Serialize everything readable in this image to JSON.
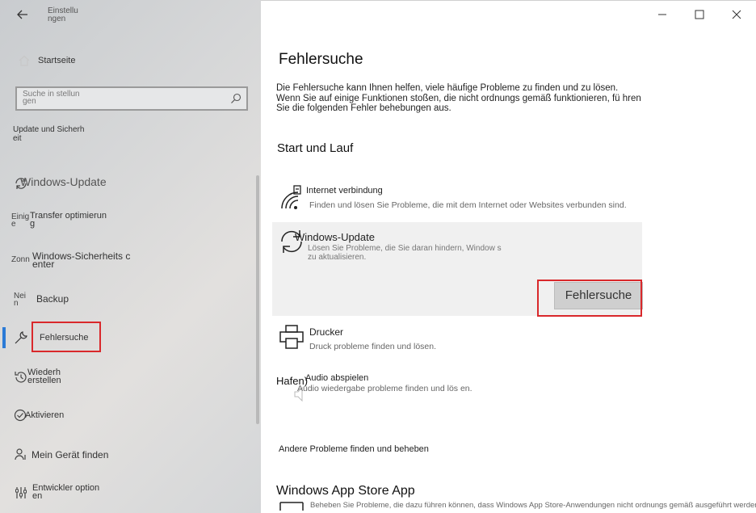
{
  "window": {
    "title": "Einstellu ngen"
  },
  "sidebar": {
    "home_label": "Startseite",
    "search_placeholder": "Suche in stellun gen",
    "section_label": "Update und Sicherh eit",
    "items": [
      {
        "label": "Windows-Update",
        "icon": "sync-icon"
      },
      {
        "prefix": "Einig e",
        "label": "Transfer optimierun g",
        "icon": "transfer-icon"
      },
      {
        "prefix": "Zonn",
        "label": "Windows-Sicherheits c enter",
        "icon": "shield-icon"
      },
      {
        "prefix": "Nei n",
        "label": "Backup",
        "icon": "backup-icon"
      },
      {
        "label": "Fehlersuche",
        "icon": "wrench-icon",
        "active": true
      },
      {
        "label": "Wiederh erstellen",
        "icon": "restore-icon"
      },
      {
        "label": "Aktivieren",
        "icon": "check-circle-icon"
      },
      {
        "label": "Mein Gerät finden",
        "icon": "person-pin-icon"
      },
      {
        "label": "Entwickler option en",
        "icon": "developer-icon"
      }
    ]
  },
  "main": {
    "title": "Fehlersuche",
    "intro": "Die Fehlersuche kann Ihnen helfen, viele häufige Probleme zu finden und zu lösen. Wenn Sie auf einige Funktionen stoßen, die nicht ordnungs gemäß funktionieren, fü hren Sie die folgenden Fehler behebungen aus.",
    "section_start": "Start und Lauf",
    "troubleshooters": [
      {
        "name": "Internet verbindung",
        "desc": "Finden und lösen Sie Probleme, die mit dem Internet oder Websites verbunden sind.",
        "icon": "wifi-icon"
      },
      {
        "name": "Windows-Update",
        "desc": "Lösen Sie Probleme, die Sie daran hindern, Window s zu aktualisieren.",
        "icon": "sync-icon",
        "button": "Fehlersuche"
      },
      {
        "name": "Drucker",
        "desc": "Druck probleme finden und lösen.",
        "icon": "printer-icon"
      },
      {
        "name": "Audio abspielen",
        "desc": "Audio wiedergabe probleme finden und lös en.",
        "icon": "speaker-icon"
      }
    ],
    "hafen": "Hafen)",
    "other_label": "Andere Probleme finden und beheben",
    "store_title": "Windows App Store App",
    "store_desc": "Beheben Sie Probleme, die dazu führen können, dass Windows App Store-Anwendungen nicht ordnungs gemäß ausgeführt werden"
  },
  "colors": {
    "accent": "#2b7ad6",
    "highlight": "#d9282b"
  }
}
